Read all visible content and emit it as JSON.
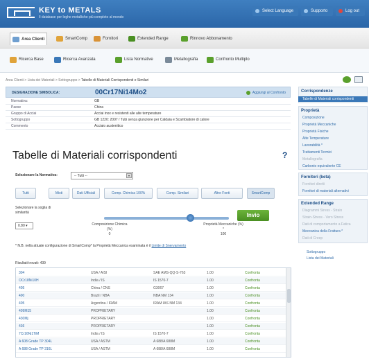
{
  "header": {
    "logo_title": "KEY to METALS",
    "logo_subtitle": "Il database per leghe metalliche più completo al mondo",
    "select_language": "Select Language",
    "support": "Supporto",
    "logout": "Log out"
  },
  "nav": {
    "tabs": [
      "Area Clienti",
      "SmartComp",
      "Fornitori",
      "Extended Range",
      "Rinnovo Abbonamento"
    ]
  },
  "toolbar": {
    "items": [
      "Ricerca Base",
      "Ricerca Avanzata",
      "Lista Normative",
      "Metallografia",
      "Confronto Multiplo"
    ]
  },
  "breadcrumb": {
    "items": [
      "Area Clienti",
      "Lista dei Materiali",
      "Sottogruppo"
    ],
    "current": "Tabelle di Materiali Corrispondenti e Similari"
  },
  "material": {
    "designation_label": "DESIGNAZIONE SIMBOLICA:",
    "designation": "00Cr17Ni14Mo2",
    "add_compare": "Aggiungi al Confronto",
    "rows": [
      {
        "k": "Normativa:",
        "v": "GB"
      },
      {
        "k": "Paese",
        "v": "China"
      },
      {
        "k": "Gruppo di Acciai",
        "v": "Acciai inox e resistenti alle alte temperature"
      },
      {
        "k": "Sottogruppo",
        "v": "GB 1220: 2007 / Tubi senza giunzione per Caldaia e Scambiatore di calore"
      },
      {
        "k": "Commento",
        "v": "Acciaio austenitico"
      }
    ]
  },
  "main": {
    "title": "Tabelle di Materiali corrispondenti",
    "help": "?",
    "norm_label": "Selezionare la Normativa:",
    "norm_value": "-- Tutti --",
    "filter_tabs": [
      "Tutti",
      "Misti",
      "Dati Ufficiali",
      "Comp. Chimica 100%",
      "Comp. Similari",
      "Altre Fonti",
      "SmartComp"
    ],
    "slider_label": "Selezionare la soglia di similarità",
    "slider_value": "0.80 ▾",
    "slider_position": 0.69,
    "comp_label": "Composizione Chimica (%)",
    "comp_value": "0",
    "prop_label": "Proprietà Meccaniche (%) *",
    "prop_value": "100",
    "invio": "Invio",
    "note_prefix": "* N.B. nella attuale configurazione di SmartComp* la Proprietà Meccanica esaminata è il",
    "note_link": "Limite di Snervamento",
    "results_count": "Risultati trovati: 439",
    "results": [
      [
        "304",
        "USA / AISI",
        "SAE AMS-QQ-S-763",
        "1.00",
        "Confronta"
      ],
      [
        "OCr18Ni10H",
        "India / IS",
        "IS 1570-7",
        "1.00",
        "Confronta"
      ],
      [
        "405",
        "China / CNS",
        "G3067",
        "1.00",
        "Confronta"
      ],
      [
        "490",
        "Brazil / NBA",
        "NBA NM 134",
        "1.00",
        "Confronta"
      ],
      [
        "405",
        "Argentina / IRAM",
        "IRAM IAS NM 134",
        "1.00",
        "Confronta"
      ],
      [
        "409M15",
        "PROPRIETARY",
        "",
        "1.00",
        "Confronta"
      ],
      [
        "430Mj",
        "PROPRIETARY",
        "",
        "1.00",
        "Confronta"
      ],
      [
        "436",
        "PROPRIETARY",
        "",
        "1.00",
        "Confronta"
      ],
      [
        "7Cr16Ni1TiM",
        "India / IS",
        "IS 1570-7",
        "1.00",
        "Confronta"
      ],
      [
        "A 608 Grade TP 304L",
        "USA / ASTM",
        "A 688/A 688M",
        "1.00",
        "Confronta"
      ],
      [
        "A 688 Grade TP 316L",
        "USA / ASTM",
        "A 688/A 688M",
        "1.00",
        "Confronta"
      ]
    ]
  },
  "sidebar": {
    "correspondence_title": "Corrispondenze",
    "correspondence_items": [
      "Tabelle di Materiali corrispondenti"
    ],
    "properties_title": "Proprietà",
    "properties_items": [
      "Composizione",
      "Proprietà Meccaniche",
      "Proprietà Fisiche",
      "Alte Temperature",
      "Lavorabilità *",
      "Trattamenti Termici",
      "Metallografia",
      "Carbonio equivalente CE"
    ],
    "suppliers_title": "Fornitori (beta)",
    "suppliers_items": [
      "Fornitori diretti",
      "Fornitori di materiali alternativi"
    ],
    "extended_title": "Extended Range",
    "extended_items": [
      "Diagrammi Stress - Strain",
      "Strain-Stress - Vero Stress",
      "Dati di comportamento a Fatica",
      "Meccanica della Frattura *",
      "Dati di Creep"
    ],
    "back_subgroup": "Sottogruppo",
    "back_list": "Lista dei Materiali"
  }
}
